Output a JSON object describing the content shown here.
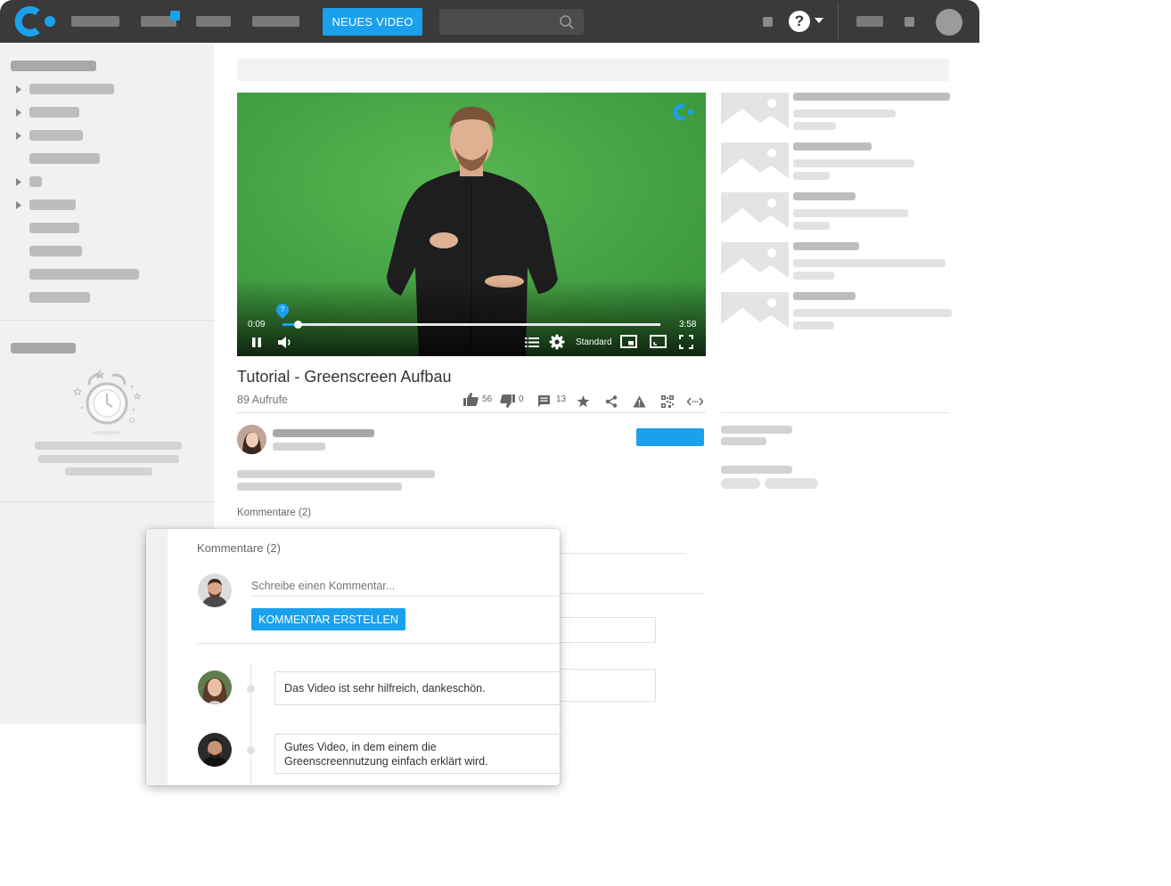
{
  "colors": {
    "accent": "#1ba1ec",
    "topbar": "#3a3a3a",
    "greenscreen": "#4aa548"
  },
  "topbar": {
    "new_video_label": "NEUES VIDEO",
    "search_icon": "search-icon",
    "help_icon": "help-icon"
  },
  "player": {
    "current_time": "0:09",
    "duration": "3:58",
    "progress": 0.04,
    "quality_label": "Standard",
    "chapter_marker": "?"
  },
  "video": {
    "title": "Tutorial - Greenscreen Aufbau",
    "views": "89 Aufrufe",
    "likes": "56",
    "dislikes": "0",
    "comments": "13"
  },
  "background_comments_header": "Kommentare (2)",
  "comments_panel": {
    "header": "Kommentare (2)",
    "input_placeholder": "Schreibe einen Kommentar...",
    "submit_label": "KOMMENTAR ERSTELLEN",
    "items": [
      {
        "text": "Das Video ist sehr hilfreich, dankeschön."
      },
      {
        "text": "Gutes Video, in dem einem die Greenscreennutzung einfach erklärt wird."
      }
    ]
  }
}
